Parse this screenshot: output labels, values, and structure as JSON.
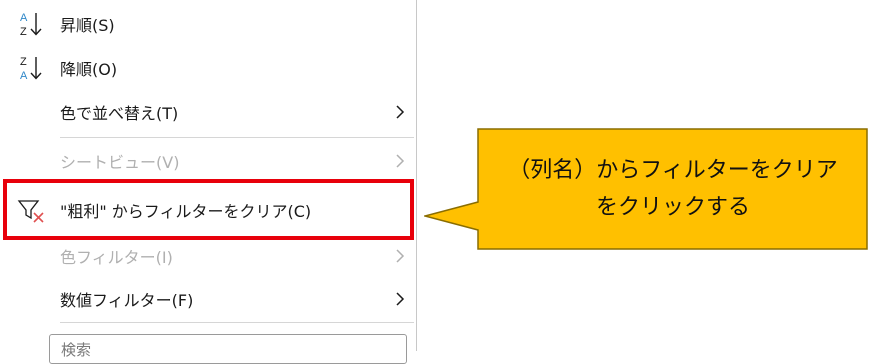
{
  "menu": {
    "sort_asc": {
      "label": "昇順(S)",
      "icon": "sort-ascending-icon"
    },
    "sort_desc": {
      "label": "降順(O)",
      "icon": "sort-descending-icon"
    },
    "sort_by_color": {
      "label": "色で並べ替え(T)"
    },
    "sheet_view": {
      "label": "シートビュー(V)"
    },
    "clear_filter": {
      "label": "\"粗利\" からフィルターをクリア(C)",
      "icon": "clear-filter-icon"
    },
    "color_filter": {
      "label": "色フィルター(I)"
    },
    "number_filter": {
      "label": "数値フィルター(F)"
    },
    "search": {
      "placeholder": "検索"
    }
  },
  "callout": {
    "line1": "（列名）からフィルターをクリア",
    "line2": "をクリックする"
  },
  "colors": {
    "highlight_border": "#e8000b",
    "callout_fill": "#ffc000",
    "callout_border": "#8a6d00",
    "sort_icon_blue": "#2e87c8",
    "disabled_text": "#b0b0b0"
  }
}
